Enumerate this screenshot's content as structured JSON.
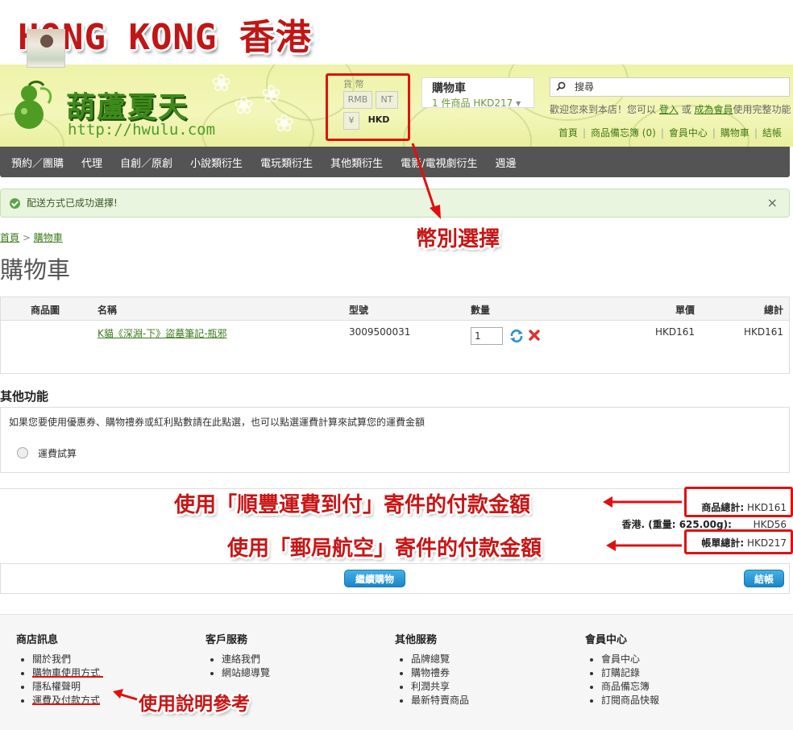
{
  "overlay": {
    "title": "HONG KONG 香港",
    "callout_currency": "幣別選擇",
    "callout_sf": "使用「順豐運費到付」寄件的付款金額",
    "callout_post": "使用「郵局航空」寄件的付款金額",
    "callout_guide": "使用說明參考"
  },
  "header": {
    "logo_text": "葫蘆夏天",
    "logo_url": "http://hwulu.com",
    "currency_label": "貨 幣",
    "currency_options": [
      "RMB",
      "NT",
      "¥",
      "HKD"
    ],
    "currency_selected": "HKD",
    "cart_title": "購物車",
    "cart_summary": "1 件商品 HKD217",
    "search_placeholder": "搜尋",
    "welcome_prefix": "歡迎您來到本店！您可以",
    "login_link": "登入",
    "welcome_or": "或",
    "register_link": "成為會員",
    "welcome_suffix": "使用完整功能",
    "top_links": [
      "首頁",
      "商品備忘簿 (0)",
      "會員中心",
      "購物車",
      "結帳"
    ]
  },
  "nav": [
    "預約／團購",
    "代理",
    "自創／原創",
    "小說類衍生",
    "電玩類衍生",
    "其他類衍生",
    "電影/電視劇衍生",
    "週邊"
  ],
  "alert": {
    "message": "配送方式已成功選擇!",
    "close": "×"
  },
  "breadcrumb": {
    "home": "首頁",
    "sep": ">",
    "current": "購物車"
  },
  "page_title": "購物車",
  "cart": {
    "headers": {
      "image": "商品圖",
      "name": "名稱",
      "model": "型號",
      "qty": "數量",
      "unit_price": "單價",
      "total": "總計"
    },
    "items": [
      {
        "name": "K貓《深淵-下》盜墓筆記-瓶邪",
        "model": "3009500031",
        "qty": "1",
        "unit_price": "HKD161",
        "total": "HKD161"
      }
    ]
  },
  "other": {
    "title": "其他功能",
    "description": "如果您要使用優惠券、購物禮券或紅利點數請在此點選，也可以點選運費計算來試算您的運費金額",
    "option_label": "運費試算"
  },
  "totals": {
    "subtotal_label": "商品總計:",
    "subtotal_value": "HKD161",
    "shipping_label": "香港. (重量: 625.00g):",
    "shipping_value": "HKD56",
    "grand_label": "帳單總計:",
    "grand_value": "HKD217"
  },
  "buttons": {
    "continue": "繼續購物",
    "checkout": "結帳"
  },
  "footer": {
    "columns": [
      {
        "title": "商店訊息",
        "links": [
          "關於我們",
          "購物車使用方式",
          "隱私權聲明",
          "運費及付款方式"
        ]
      },
      {
        "title": "客戶服務",
        "links": [
          "連絡我們",
          "網站總導覽"
        ]
      },
      {
        "title": "其他服務",
        "links": [
          "品牌總覽",
          "購物禮券",
          "利潤共享",
          "最新特賣商品"
        ]
      },
      {
        "title": "會員中心",
        "links": [
          "會員中心",
          "訂購記錄",
          "商品備忘簿",
          "訂閱商品快報"
        ]
      }
    ]
  },
  "colors": {
    "accent_red": "#e01010",
    "nav_bg": "#545454",
    "link_green": "#3a7a1a",
    "button_blue": "#1a86c7"
  }
}
